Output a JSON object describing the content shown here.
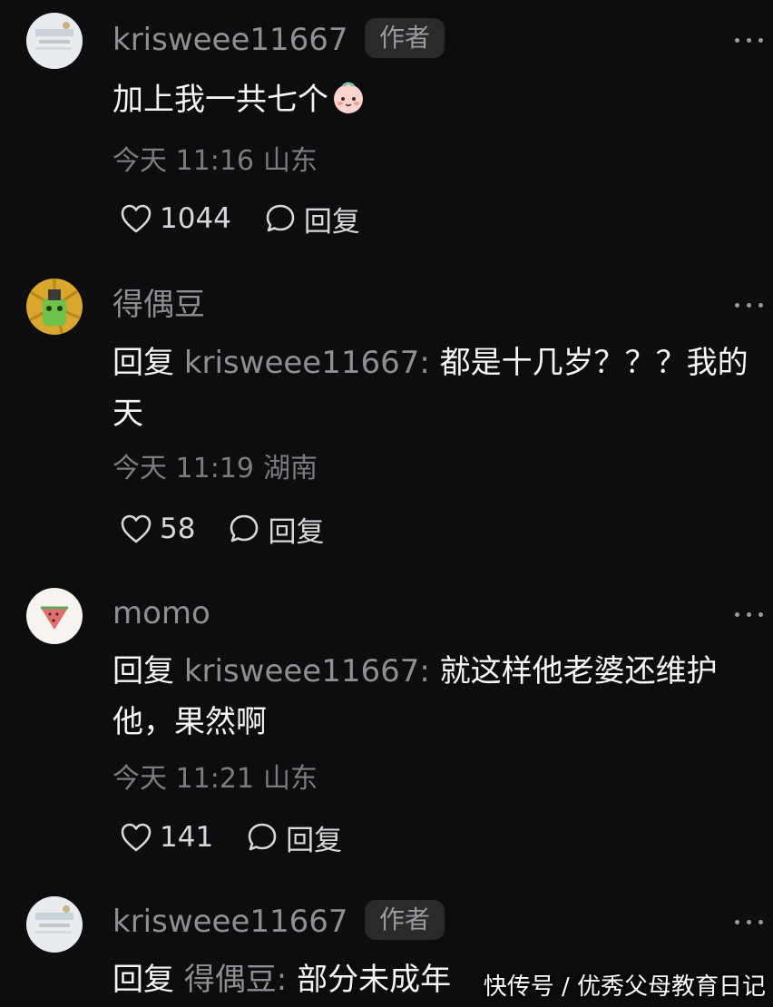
{
  "comments": [
    {
      "username": "krisweee11667",
      "badge": "作者",
      "text": "加上我一共七个",
      "emoji": "face-emoji",
      "time": "今天 11:16",
      "location": "山东",
      "likes": "1044",
      "reply_label": "回复"
    },
    {
      "username": "得偶豆",
      "reply_prefix": "回复",
      "reply_target": "krisweee11667:",
      "text": " 都是十几岁？？？我的天",
      "time": "今天 11:19",
      "location": "湖南",
      "likes": "58",
      "reply_label": "回复"
    },
    {
      "username": "momo",
      "reply_prefix": "回复",
      "reply_target": "krisweee11667:",
      "text": " 就这样他老婆还维护他，果然啊",
      "time": "今天 11:21",
      "location": "山东",
      "likes": "141",
      "reply_label": "回复"
    },
    {
      "username": "krisweee11667",
      "badge": "作者",
      "reply_prefix": "回复",
      "reply_target": "得偶豆:",
      "text": " 部分未成年"
    }
  ],
  "watermark": "快传号 / 优秀父母教育日记",
  "colors": {
    "background": "#0d0d0f",
    "username": "#8e8e93",
    "badge_bg": "#2a2a2d",
    "text": "#f5f5f5",
    "meta": "#7b7b80"
  }
}
